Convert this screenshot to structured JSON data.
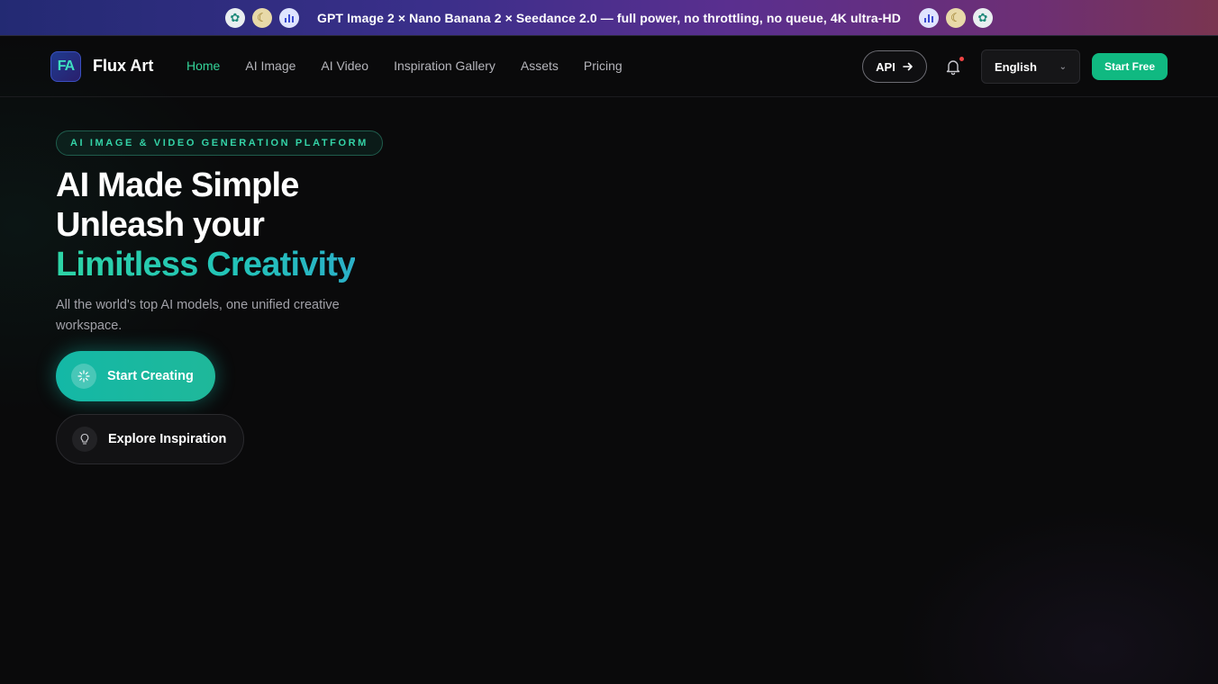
{
  "promo": {
    "text": "GPT Image 2 × Nano Banana 2 × Seedance 2.0 — full power, no throttling, no queue, 4K ultra-HD",
    "icons": [
      "openai-icon",
      "banana-icon",
      "bar-chart-icon"
    ]
  },
  "nav": {
    "brand": "Flux Art",
    "logo_text": "FA",
    "links": [
      "Home",
      "AI Image",
      "AI Video",
      "Inspiration Gallery",
      "Assets",
      "Pricing"
    ],
    "active": "Home",
    "api_label": "API",
    "language": "English",
    "start_free": "Start Free"
  },
  "hero": {
    "badge": "AI IMAGE & VIDEO GENERATION PLATFORM",
    "title_line1": "AI Made Simple",
    "title_line2": "Unleash your",
    "title_line3": "Limitless Creativity",
    "subtitle": "All the world's top AI models, one unified creative workspace.",
    "primary_cta": "Start Creating",
    "secondary_cta": "Explore Inspiration"
  },
  "colors": {
    "accent": "#10b981",
    "accent_teal": "#14b8a6",
    "background": "#0a0a0b"
  }
}
